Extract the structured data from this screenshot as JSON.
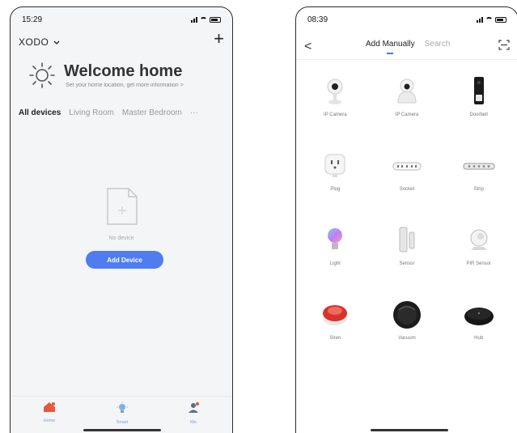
{
  "left_phone": {
    "status_time": "15:29",
    "home_selector": "XODO",
    "add_symbol": "+",
    "welcome_title": "Welcome home",
    "welcome_subtitle": "Set your home location, get more information",
    "rooms": [
      "All devices",
      "Living Room",
      "Master Bedroom",
      "···"
    ],
    "empty_text": "No device",
    "add_button": "Add Device",
    "tabs": [
      {
        "label": "Home",
        "icon": "home-icon"
      },
      {
        "label": "Smart",
        "icon": "smart-icon"
      },
      {
        "label": "Me",
        "icon": "profile-icon"
      }
    ]
  },
  "right_phone": {
    "status_time": "08:39",
    "back_symbol": "<",
    "tabs": [
      "Add Manually",
      "Search"
    ],
    "devices": [
      {
        "name": "IP Camera",
        "icon": "ip-camera-icon"
      },
      {
        "name": "IP Camera",
        "icon": "ptz-camera-icon"
      },
      {
        "name": "Doorbell",
        "icon": "doorbell-icon"
      },
      {
        "name": "Plug",
        "icon": "plug-icon"
      },
      {
        "name": "Socket",
        "icon": "socket-icon"
      },
      {
        "name": "Strip",
        "icon": "strip-icon"
      },
      {
        "name": "Light",
        "icon": "light-bulb-icon"
      },
      {
        "name": "Sensor",
        "icon": "door-sensor-icon"
      },
      {
        "name": "PIR Sensor",
        "icon": "pir-sensor-icon"
      },
      {
        "name": "Siren",
        "icon": "siren-icon"
      },
      {
        "name": "Vacuum",
        "icon": "vacuum-icon"
      },
      {
        "name": "Hub",
        "icon": "hub-icon"
      }
    ]
  },
  "colors": {
    "accent": "#4f7df0",
    "tab_icon": "#7a9be0"
  }
}
